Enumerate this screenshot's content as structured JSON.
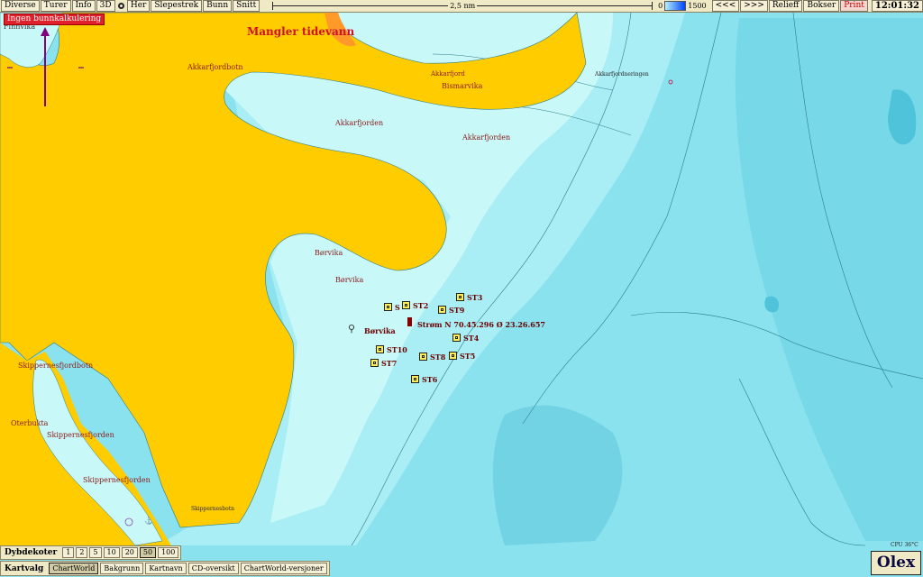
{
  "toolbar": {
    "buttons": [
      "Diverse",
      "Turer",
      "Info",
      "3D"
    ],
    "buttons2": [
      "Her",
      "Slepestrek",
      "Bunn",
      "Snitt"
    ],
    "scale_label": "2,5 nm",
    "depth_min": "0",
    "depth_max": "1500",
    "nav_back": "<<<",
    "nav_fwd": ">>>",
    "relief": "Relieff",
    "bokser": "Bokser",
    "print": "Print",
    "clock": "12:01:32"
  },
  "warning": "Ingen bunnkalkulering",
  "map_warning": "Mangler tidevann",
  "place_labels": {
    "finnvika": "Finnvika",
    "akkarfjordbotn": "Akkarfjordbotn",
    "akkarfjord": "Akkarfjord",
    "bismarvika": "Bismarvika",
    "akkarfjordneringen": "Akkarfjordneringen",
    "akkarfjorden1": "Akkarfjorden",
    "akkarfjorden2": "Akkarfjorden",
    "borvika1": "Børvika",
    "borvika2": "Børvika",
    "borvika3": "Børvika",
    "skippernesfjordbotn": "Skippernesfjordbotn",
    "oterbukta": "Oterbukta",
    "skippernesfjorden1": "Skippernesfjorden",
    "skippernesfjorden2": "Skippernesfjorden",
    "skippernesbotn": "Skippernesbotn"
  },
  "stations": {
    "st1": "S",
    "st2": "ST2",
    "st3": "ST3",
    "st4": "ST4",
    "st5": "ST5",
    "st6": "ST6",
    "st7": "ST7",
    "st8": "ST8",
    "st9": "ST9",
    "st10": "ST10"
  },
  "current_marker": "Strøm N 70.45.296 Ø 23.26.657",
  "bottom": {
    "depth_title": "Dybdekoter",
    "depth_options": [
      "1",
      "2",
      "5",
      "10",
      "20",
      "50",
      "100"
    ],
    "depth_selected": "50",
    "chart_title": "Kartvalg",
    "chart_options": [
      "ChartWorld",
      "Bakgrunn",
      "Kartnavn",
      "CD-oversikt",
      "ChartWorld-versjoner"
    ],
    "chart_selected": "ChartWorld"
  },
  "status": {
    "cpu": "CPU 36°C",
    "brand": "Olex"
  },
  "colors": {
    "land": "#ffcc00",
    "shallow": "#c9f8f8",
    "mid": "#a8f0f4",
    "deep": "#7ee0ec",
    "deeper": "#5fd0e2",
    "warning_red": "#e0202a"
  }
}
